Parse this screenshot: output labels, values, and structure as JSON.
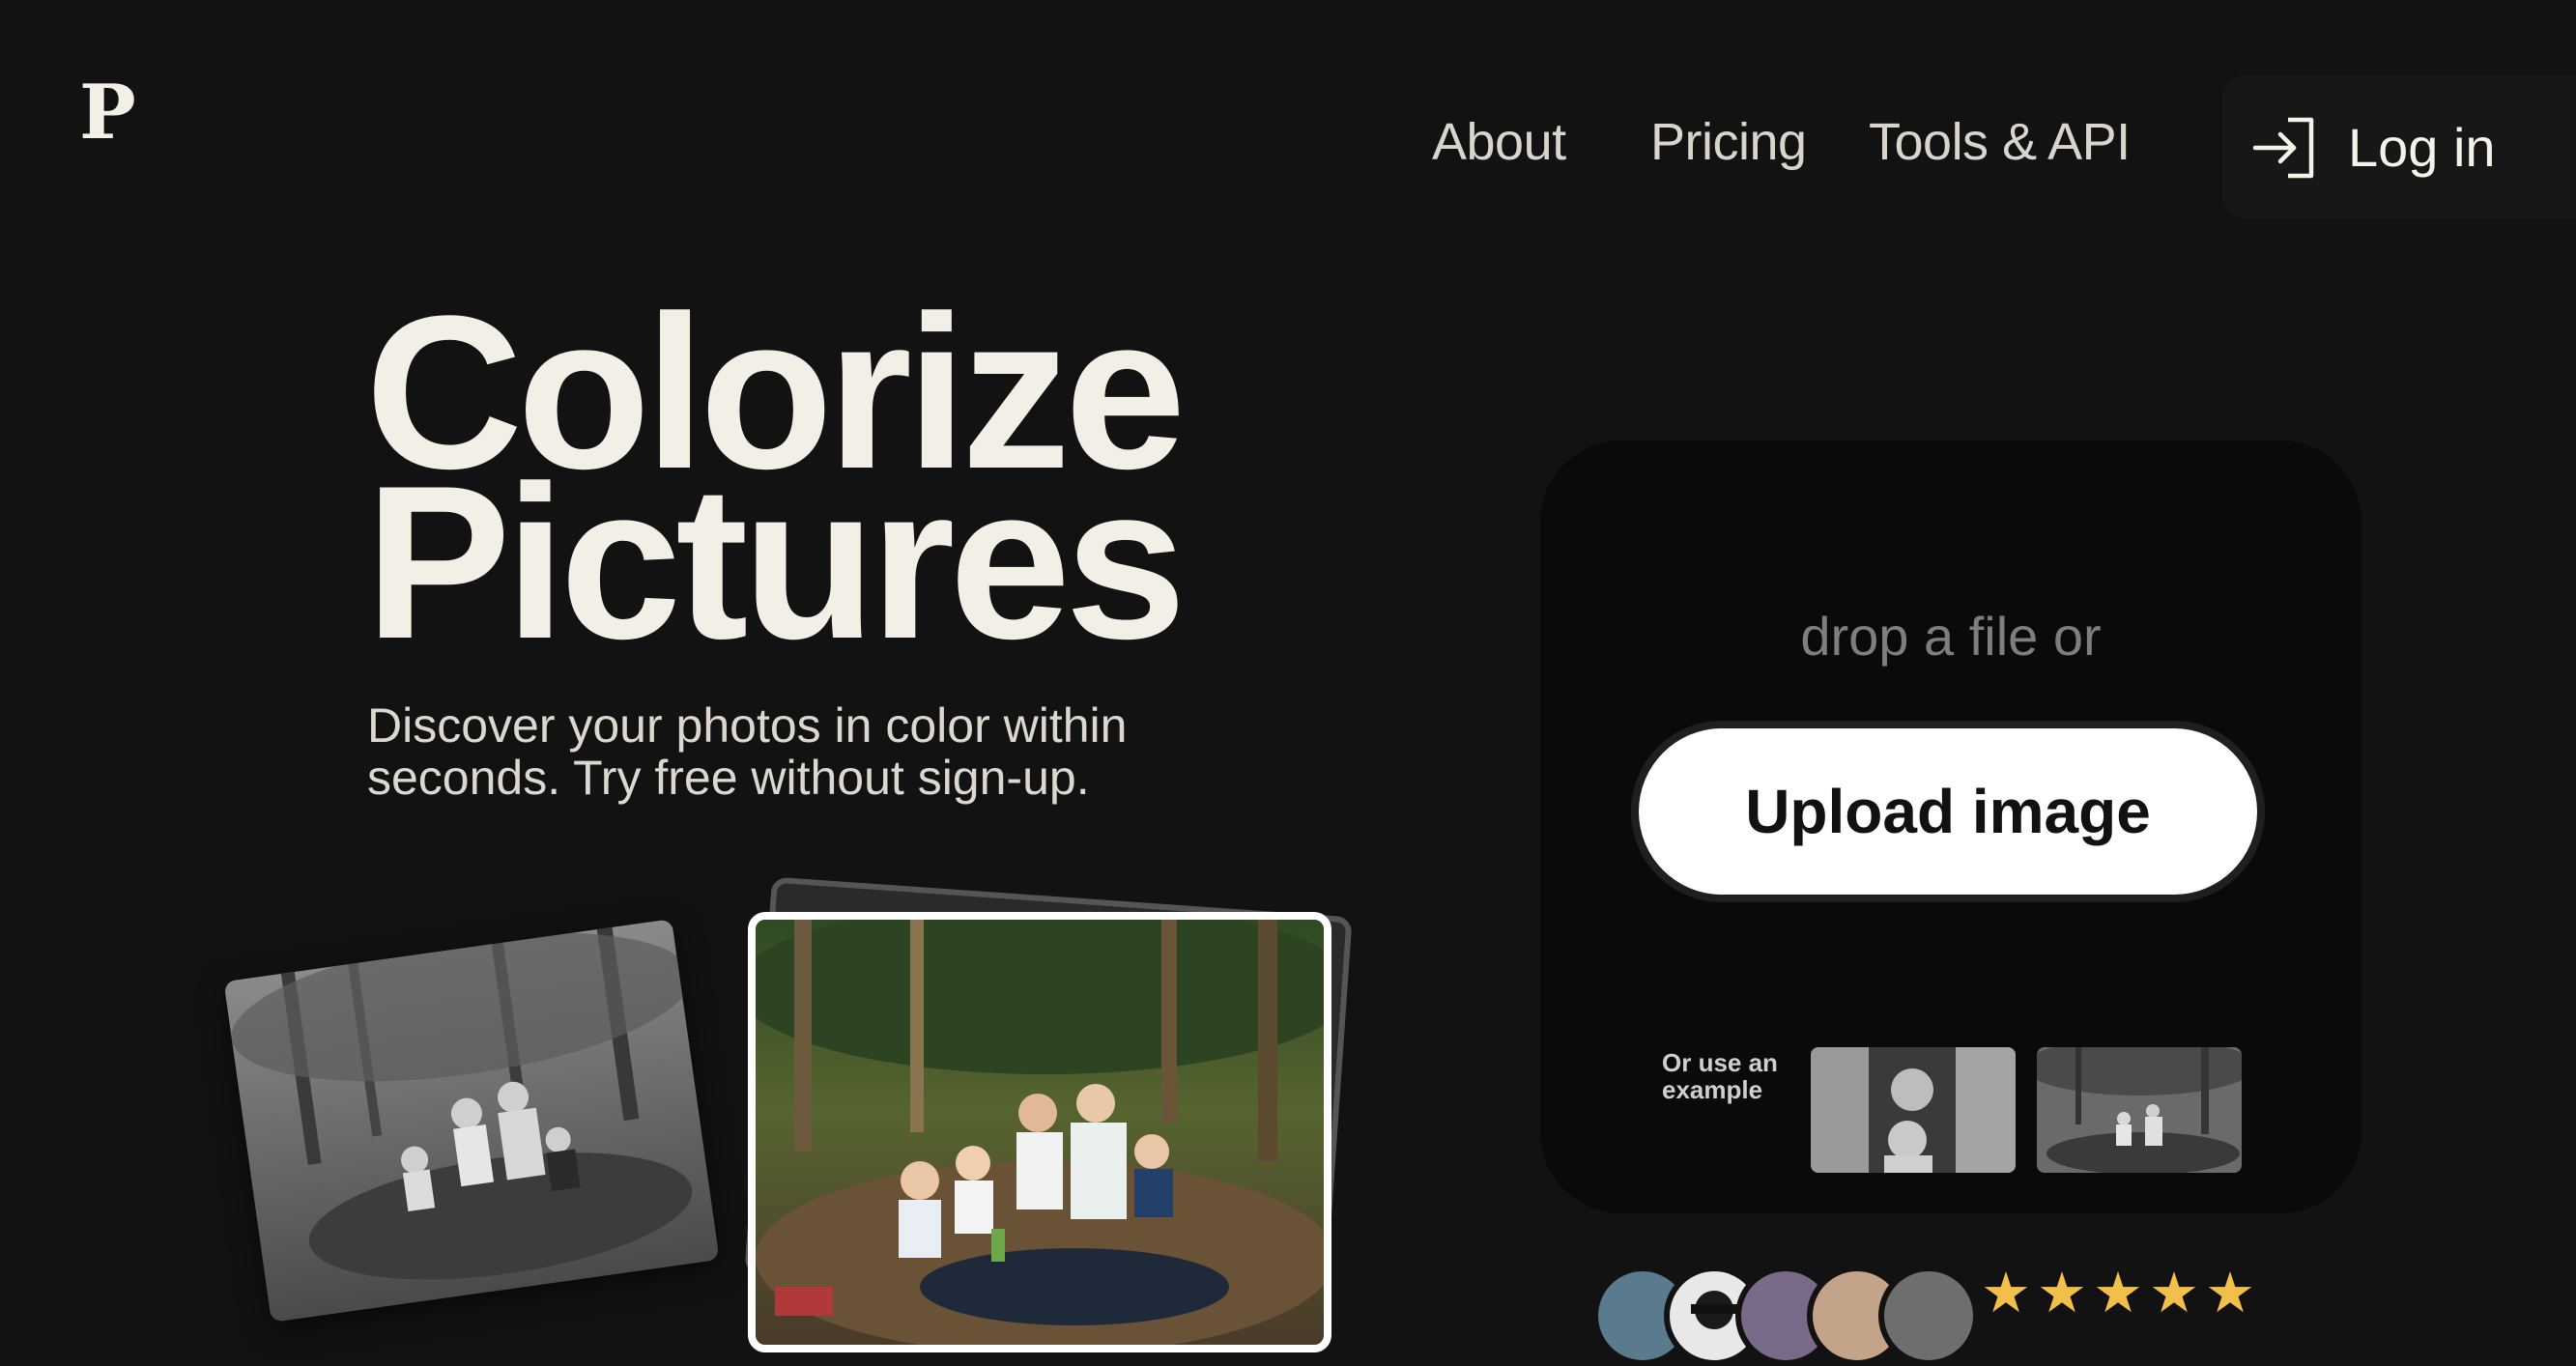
{
  "brand": {
    "logo_text": "P"
  },
  "nav": {
    "items": [
      {
        "label": "About"
      },
      {
        "label": "Pricing"
      },
      {
        "label": "Tools & API"
      }
    ],
    "login_label": "Log in"
  },
  "hero": {
    "title_line1": "Colorize",
    "title_line2": "Pictures",
    "subtitle_line1": "Discover your photos in color within",
    "subtitle_line2": "seconds. Try free without sign-up."
  },
  "upload": {
    "drop_text": "drop a file or",
    "button_label": "Upload image",
    "example_label": "Or use an example"
  },
  "rating": {
    "stars": 5,
    "stars_text": "★★★★★"
  },
  "icons": {
    "login": "log-in-icon",
    "star": "star-icon"
  },
  "colors": {
    "background": "#121212",
    "text": "#f3efe6",
    "button_bg": "#ffffff",
    "star": "#f2c04a"
  }
}
